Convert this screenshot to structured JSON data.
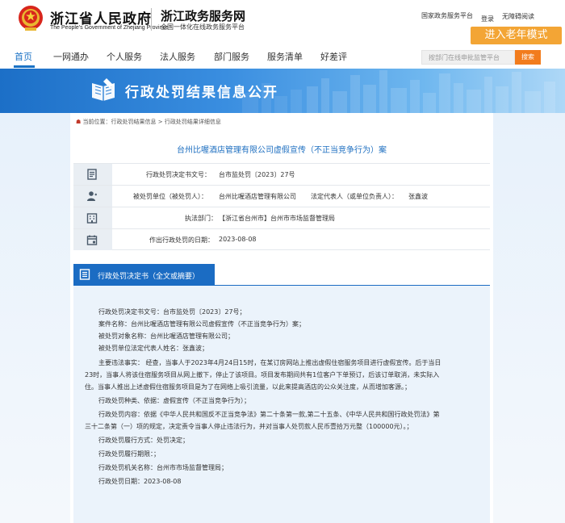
{
  "header": {
    "gov_title": "浙江省人民政府",
    "gov_subtitle": "The People's Government of Zhejiang Province",
    "service_title": "浙江政务服务网",
    "service_subtitle": "全国一体化在线政务服务平台",
    "links": [
      "国家政务服务平台",
      "登录",
      "无障碍阅读"
    ],
    "elder_mode": "进入老年模式"
  },
  "nav": {
    "items": [
      "首页",
      "一网通办",
      "个人服务",
      "法人服务",
      "部门服务",
      "服务清单",
      "好差评"
    ],
    "active": "首页",
    "search_placeholder": "按部门在线申批监管平台",
    "search_button": "搜索"
  },
  "banner": {
    "title": "行政处罚结果信息公开"
  },
  "breadcrumb": {
    "prefix": "当前位置：",
    "path": "行政处罚结果信息 > 行政处罚结果详细信息"
  },
  "case": {
    "title": "台州比喔酒店管理有限公司虚假宣传（不正当竞争行为）案",
    "rows": [
      {
        "icon": "document-icon",
        "label": "行政处罚决定书文号：",
        "value": "台市监处罚〔2023〕27号"
      },
      {
        "icon": "person-icon",
        "label": "被处罚单位（被处罚人）：",
        "value": "台州比喔酒店管理有限公司",
        "label2": "法定代表人（或单位负责人）：",
        "value2": "张鑫波"
      },
      {
        "icon": "building-icon",
        "label": "执法部门：",
        "value": "【浙江省台州市】台州市市场监督管理局"
      },
      {
        "icon": "calendar-icon",
        "label": "作出行政处罚的日期：",
        "value": "2023-08-08"
      }
    ]
  },
  "decision": {
    "header": "行政处罚决定书（全文或摘要）",
    "paragraphs": [
      "行政处罚决定书文号：台市监处罚〔2023〕27号；",
      "案件名称：台州比喔酒店管理有限公司虚假宣传（不正当竞争行为）案；",
      "被处罚对象名称：台州比喔酒店管理有限公司；",
      "被处罚单位法定代表人姓名：张鑫波；",
      "主要违法事实：  经查，当事人于2023年4月24日15时，在某订房网站上推出虚假住宿服务项目进行虚假宣传。后于当日",
      "23时，当事人将该住宿服务项目从网上撤下，停止了该项目。项目发布期间共有1位客户下单预订，后该订单取消，未实际入",
      "住。当事人推出上述虚假住宿服务项目是为了在网络上吸引流量，以此来提高酒店的公众关注度，从而增加客源。；",
      "行政处罚种类、依据：虚假宣传（不正当竞争行为）；",
      "行政处罚内容：依据《中华人民共和国反不正当竞争法》第二十条第一款,第二十五条、《中华人民共和国行政处罚法》第",
      "三十二条第（一）项的规定，决定责令当事人停止违法行为，并对当事人处罚款人民币壹拾万元整（100000元）。；",
      "行政处罚履行方式：处罚决定；",
      "行政处罚履行期限：；",
      "行政处罚机关名称：台州市市场监督管理局；",
      "行政处罚日期：2023-08-08"
    ]
  },
  "colors": {
    "primary": "#1b6cc3",
    "accent": "#f3a535",
    "search": "#f27c1d"
  }
}
